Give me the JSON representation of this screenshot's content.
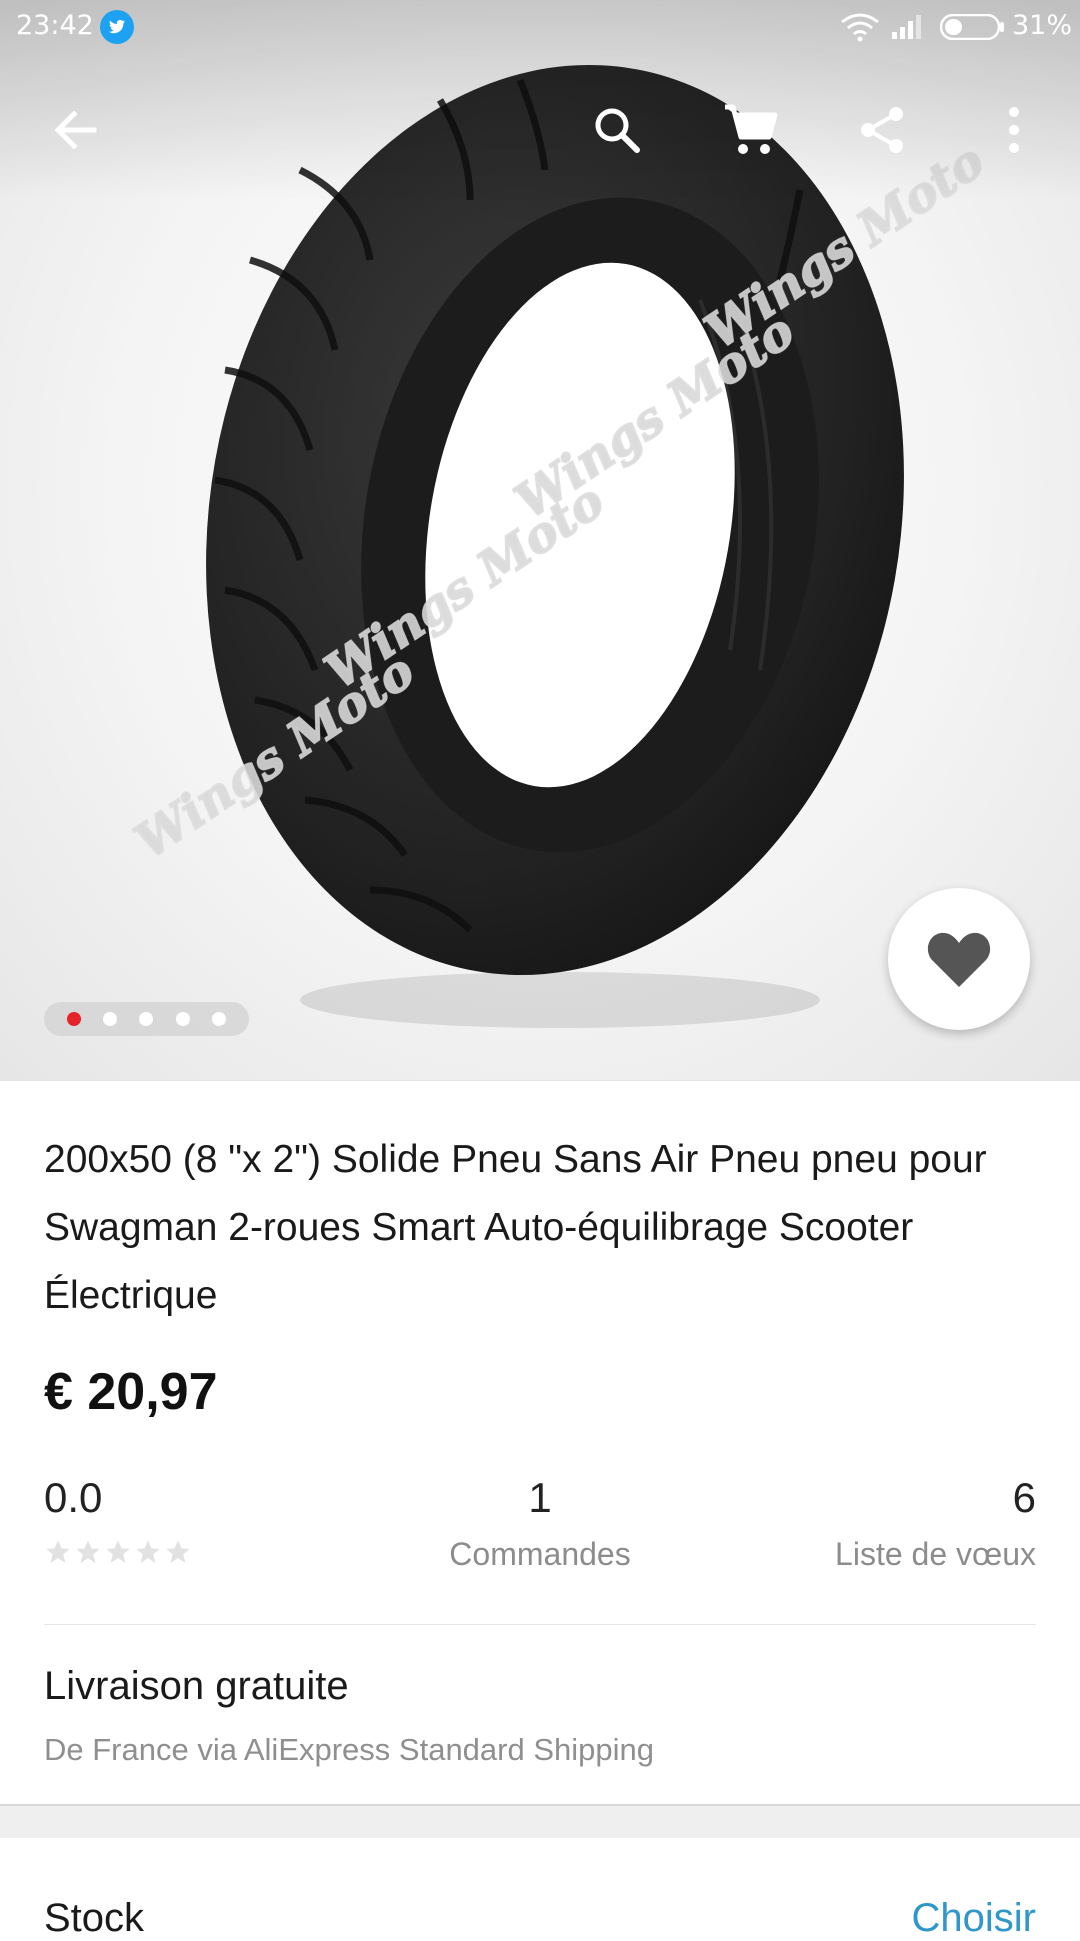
{
  "status_bar": {
    "time": "23:42",
    "battery_percent": "31%",
    "notification_icon": "twitter-icon"
  },
  "toolbar": {
    "icons": [
      "back-arrow-icon",
      "search-icon",
      "cart-icon",
      "share-icon",
      "more-vert-icon"
    ]
  },
  "gallery": {
    "watermark": "Wings Moto",
    "image_count": 5,
    "active_index": 0,
    "accent_color": "#e6222a"
  },
  "product": {
    "title": "200x50 (8 \"x 2\") Solide Pneu Sans Air Pneu pneu pour Swagman 2-roues Smart Auto-équilibrage Scooter Électrique",
    "price": "€ 20,97"
  },
  "stats": {
    "rating": "0.0",
    "stars": 0,
    "orders": "1",
    "orders_label": "Commandes",
    "wishlist": "6",
    "wishlist_label": "Liste de vœux"
  },
  "shipping": {
    "title": "Livraison gratuite",
    "subtitle": "De France via AliExpress Standard Shipping"
  },
  "next_section": {
    "left_label": "Stock",
    "right_label": "Choisir"
  }
}
